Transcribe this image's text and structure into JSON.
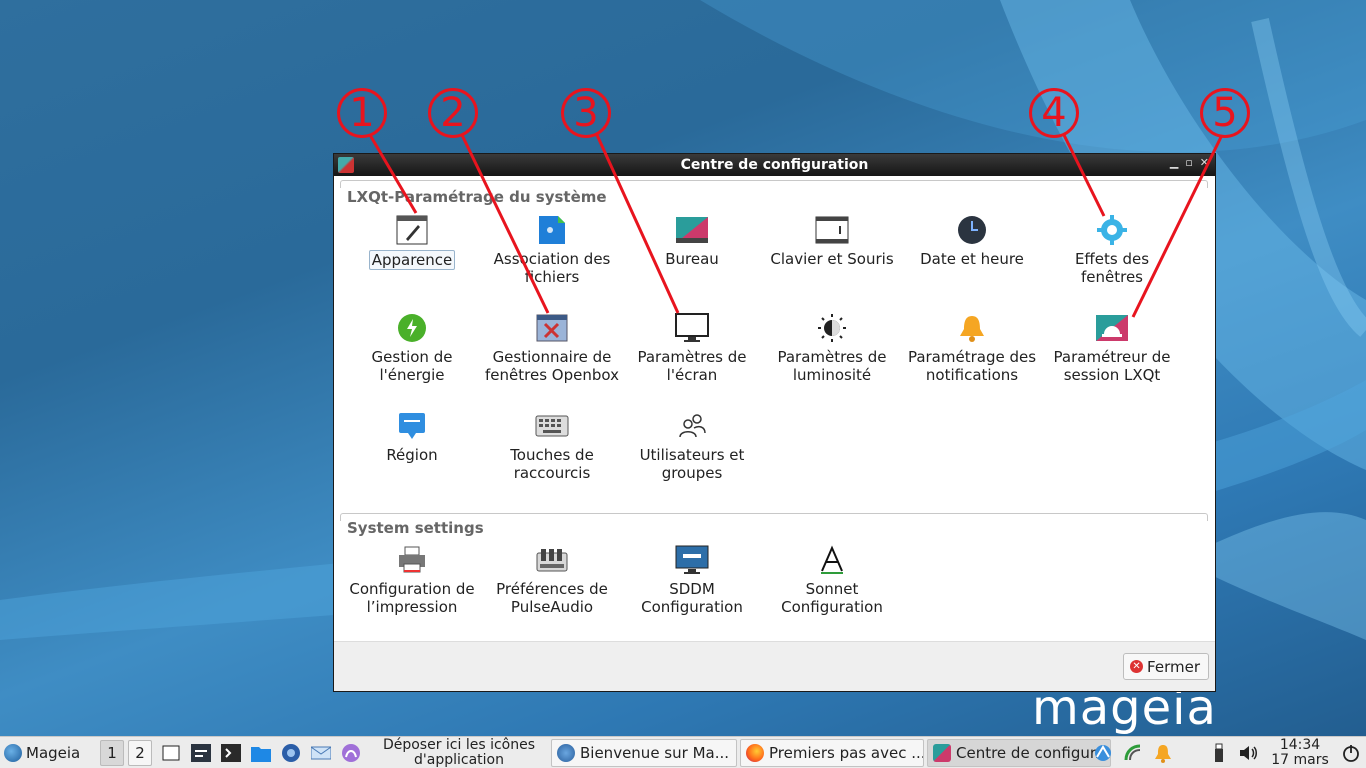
{
  "window": {
    "title": "Centre de configuration",
    "group1_title": "LXQt-Paramétrage du système",
    "group2_title": "System settings",
    "close_label": "Fermer",
    "group1_items": [
      {
        "label": "Apparence",
        "icon": "appearance-icon",
        "selected": true
      },
      {
        "label": "Association des fichiers",
        "icon": "file-association-icon"
      },
      {
        "label": "Bureau",
        "icon": "desktop-icon"
      },
      {
        "label": "Clavier et Souris",
        "icon": "keyboard-mouse-icon"
      },
      {
        "label": "Date et heure",
        "icon": "clock-icon"
      },
      {
        "label": "Effets des fenêtres",
        "icon": "window-effects-icon"
      },
      {
        "label": "Gestion de l'énergie",
        "icon": "power-icon"
      },
      {
        "label": "Gestionnaire de fenêtres Openbox",
        "icon": "openbox-icon"
      },
      {
        "label": "Paramètres de l'écran",
        "icon": "monitor-icon"
      },
      {
        "label": "Paramètres de luminosité",
        "icon": "brightness-icon"
      },
      {
        "label": "Paramétrage des notifications",
        "icon": "bell-icon"
      },
      {
        "label": "Paramétreur de session LXQt",
        "icon": "session-icon"
      },
      {
        "label": "Région",
        "icon": "region-icon"
      },
      {
        "label": "Touches de raccourcis",
        "icon": "shortcut-keys-icon"
      },
      {
        "label": "Utilisateurs et groupes",
        "icon": "users-icon"
      }
    ],
    "group2_items": [
      {
        "label": "Configuration de l’impression",
        "icon": "printer-icon"
      },
      {
        "label": "Préférences de PulseAudio",
        "icon": "pulseaudio-icon"
      },
      {
        "label": "SDDM Configuration",
        "icon": "sddm-icon"
      },
      {
        "label": "Sonnet Configuration",
        "icon": "sonnet-icon"
      }
    ]
  },
  "annotations": [
    "1",
    "2",
    "3",
    "4",
    "5"
  ],
  "desktop": {
    "logo_text": "mageia"
  },
  "taskbar": {
    "menu_label": "Mageia",
    "workspaces": [
      "1",
      "2"
    ],
    "drop_zone": "Déposer ici les icônes d'application",
    "tasks": [
      {
        "label": "Bienvenue sur Ma...",
        "icon": "welcome-icon"
      },
      {
        "label": "Premiers pas avec ...",
        "icon": "firefox-icon"
      },
      {
        "label": "Centre de configur...",
        "icon": "config-center-icon",
        "active": true
      }
    ],
    "clock_time": "14:34",
    "clock_date": "17 mars"
  },
  "colors": {
    "annotation": "#e8141e",
    "titlebar": "#1f1f1f",
    "desktop": "#2e78b3"
  }
}
